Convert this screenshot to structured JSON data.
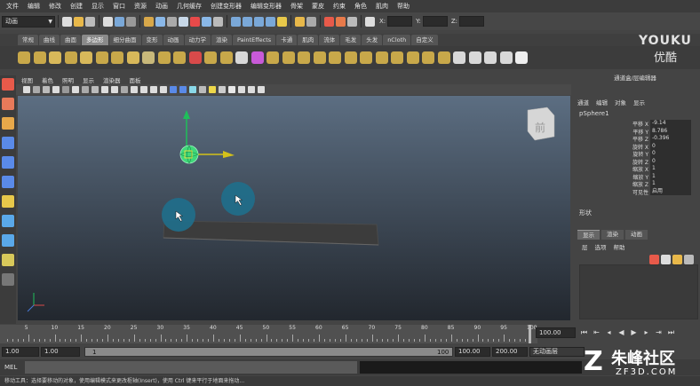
{
  "menubar": [
    "文件",
    "编辑",
    "修改",
    "创建",
    "显示",
    "窗口",
    "资源",
    "动画",
    "几何缓存",
    "创建变形器",
    "编辑变形器",
    "骨架",
    "蒙皮",
    "约束",
    "角色",
    "肌肉",
    "帮助"
  ],
  "status": {
    "mode_dropdown": "动画",
    "coord_x_label": "X:",
    "coord_y_label": "Y:",
    "coord_z_label": "Z:"
  },
  "shelf_tabs": [
    "常规",
    "曲线",
    "曲面",
    "多边形",
    "细分曲面",
    "变形",
    "动画",
    "动力学",
    "渲染",
    "PaintEffects",
    "卡通",
    "肌肉",
    "流体",
    "毛发",
    "头发",
    "nCloth",
    "自定义"
  ],
  "active_shelf_tab": "多边形",
  "viewport": {
    "menu": [
      "视图",
      "着色",
      "照明",
      "显示",
      "渲染器",
      "面板"
    ],
    "viewcube_label": "前"
  },
  "channel_box": {
    "header": "通道盒/层编辑器",
    "menu": [
      "通道",
      "编辑",
      "对象",
      "显示"
    ],
    "object_name": "pSphere1",
    "attributes": [
      {
        "label": "平移 X",
        "value": "-9.14"
      },
      {
        "label": "平移 Y",
        "value": "8.786"
      },
      {
        "label": "平移 Z",
        "value": "-0.396"
      },
      {
        "label": "旋转 X",
        "value": "0"
      },
      {
        "label": "旋转 Y",
        "value": "0"
      },
      {
        "label": "旋转 Z",
        "value": "0"
      },
      {
        "label": "缩放 X",
        "value": "1"
      },
      {
        "label": "缩放 Y",
        "value": "1"
      },
      {
        "label": "缩放 Z",
        "value": "1"
      },
      {
        "label": "可见性",
        "value": "启用"
      }
    ],
    "shapes_label": "形状"
  },
  "layer_editor": {
    "tabs": [
      "显示",
      "渲染",
      "动画"
    ],
    "active_tab": "显示",
    "menu": [
      "层",
      "选项",
      "帮助"
    ]
  },
  "timeline": {
    "ticks": [
      "5",
      "10",
      "15",
      "20",
      "25",
      "30",
      "35",
      "40",
      "45",
      "50",
      "55",
      "60",
      "65",
      "70",
      "75",
      "80",
      "85",
      "90",
      "95",
      "100"
    ],
    "current_frame": "100.00"
  },
  "range": {
    "start_time": "1.00",
    "playback_start": "1.00",
    "slider_start": "1",
    "slider_end": "100",
    "playback_end": "100.00",
    "end_time": "200.00",
    "anim_layer": "无动画层"
  },
  "command_line": {
    "label": "MEL"
  },
  "help_line": "移动工具：选择要移动的对象，使用编辑模式来更改枢轴(Insert)，使用 Ctrl 键来平行于地面来拖动...",
  "watermarks": {
    "youku_en": "YOUKU",
    "youku_cn": "优酷",
    "site_cn": "朱峰社区",
    "site_en": "ZF3D.COM"
  },
  "colors": {
    "active_tab": "#8a8a8a",
    "manip_y": "#1fbf5a",
    "manip_x": "#d4c11a",
    "selected_sphere": "#3fd87a",
    "viewport_top": "#5c6e82",
    "viewport_bottom": "#22272e"
  }
}
